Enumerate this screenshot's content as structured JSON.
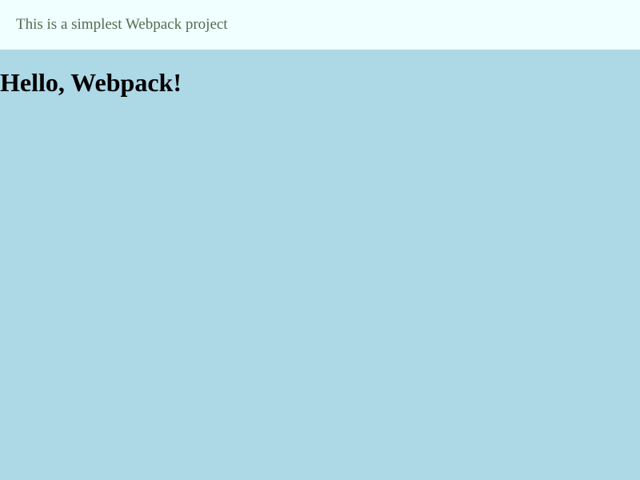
{
  "banner": {
    "text": "This is a simplest Webpack project"
  },
  "main": {
    "heading": "Hello, Webpack!"
  },
  "colors": {
    "page_background": "#add8e6",
    "banner_background": "#f0ffff",
    "banner_text": "#556b4f",
    "heading_text": "#000000"
  }
}
